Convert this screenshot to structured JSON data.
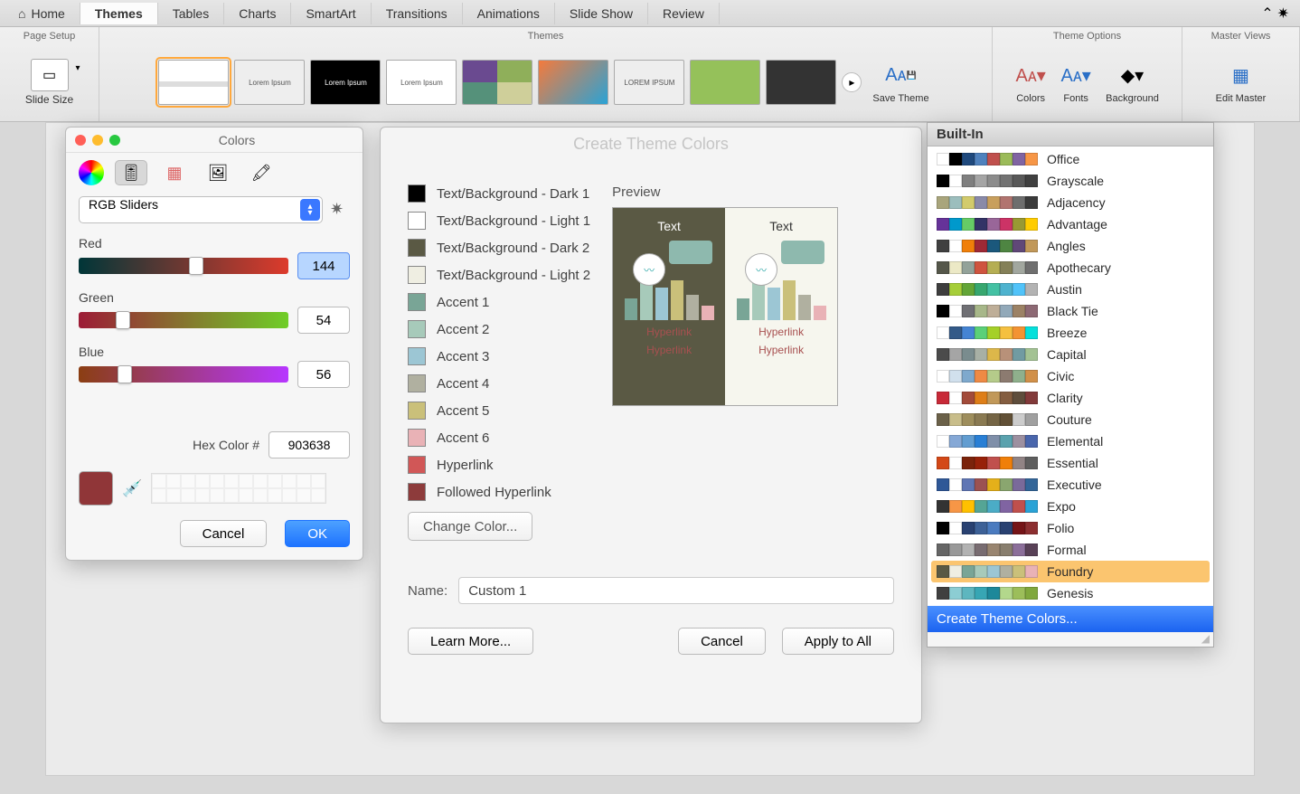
{
  "ribbon": {
    "tabs": [
      "Home",
      "Themes",
      "Tables",
      "Charts",
      "SmartArt",
      "Transitions",
      "Animations",
      "Slide Show",
      "Review"
    ],
    "active_tab": "Themes",
    "groups": {
      "page_setup": "Page Setup",
      "themes": "Themes",
      "theme_options": "Theme Options",
      "master_views": "Master Views"
    },
    "slide_size_label": "Slide Size",
    "save_theme": "Save Theme",
    "colors": "Colors",
    "fonts": "Fonts",
    "background": "Background",
    "edit_master": "Edit Master",
    "theme_thumbs": [
      {
        "label": ""
      },
      {
        "label": "Lorem Ipsum"
      },
      {
        "label": "Lorem Ipsum"
      },
      {
        "label": "Lorem Ipsum"
      },
      {
        "label": ""
      },
      {
        "label": ""
      },
      {
        "label": "LOREM IPSUM"
      },
      {
        "label": ""
      },
      {
        "label": ""
      }
    ]
  },
  "colors_window": {
    "title": "Colors",
    "mode": "RGB Sliders",
    "sliders": {
      "red": {
        "label": "Red",
        "value": "144",
        "pct": 56
      },
      "green": {
        "label": "Green",
        "value": "54",
        "pct": 21
      },
      "blue": {
        "label": "Blue",
        "value": "56",
        "pct": 22
      }
    },
    "hex_label": "Hex Color #",
    "hex_value": "903638",
    "swatch_color": "#903638",
    "cancel": "Cancel",
    "ok": "OK"
  },
  "theme_dialog": {
    "title": "Create Theme Colors",
    "slots": [
      {
        "label": "Text/Background - Dark 1",
        "color": "#000000"
      },
      {
        "label": "Text/Background - Light 1",
        "color": "#ffffff"
      },
      {
        "label": "Text/Background - Dark 2",
        "color": "#5a5944"
      },
      {
        "label": "Text/Background - Light 2",
        "color": "#efeee2"
      },
      {
        "label": "Accent 1",
        "color": "#79a596"
      },
      {
        "label": "Accent 2",
        "color": "#a7caba"
      },
      {
        "label": "Accent 3",
        "color": "#9cc6d4"
      },
      {
        "label": "Accent 4",
        "color": "#b0b0a0"
      },
      {
        "label": "Accent 5",
        "color": "#cac07a"
      },
      {
        "label": "Accent 6",
        "color": "#e9b2b6"
      },
      {
        "label": "Hyperlink",
        "color": "#d15757"
      },
      {
        "label": "Followed Hyperlink",
        "color": "#8d3b3b"
      }
    ],
    "preview_label": "Preview",
    "preview_text": "Text",
    "preview_hyperlink": "Hyperlink",
    "change_color": "Change Color...",
    "name_label": "Name:",
    "name_value": "Custom 1",
    "learn_more": "Learn More...",
    "cancel": "Cancel",
    "apply_all": "Apply to All"
  },
  "theme_panel": {
    "header": "Built-In",
    "create": "Create Theme Colors...",
    "selected": "Foundry",
    "items": [
      {
        "name": "Office",
        "c": [
          "#ffffff",
          "#000000",
          "#1f497d",
          "#4f81bd",
          "#c0504d",
          "#9bbb59",
          "#8064a2",
          "#f79646"
        ]
      },
      {
        "name": "Grayscale",
        "c": [
          "#000000",
          "#ffffff",
          "#7f7f7f",
          "#a5a5a5",
          "#8c8c8c",
          "#737373",
          "#595959",
          "#404040"
        ]
      },
      {
        "name": "Adjacency",
        "c": [
          "#a9a57c",
          "#9cbebd",
          "#d2cb6c",
          "#8a8aa8",
          "#c89f5d",
          "#b1746f",
          "#6e6e6e",
          "#3b3b3b"
        ]
      },
      {
        "name": "Advantage",
        "c": [
          "#663399",
          "#0099cc",
          "#66cc66",
          "#333366",
          "#996699",
          "#cc3366",
          "#999933",
          "#ffcc00"
        ]
      },
      {
        "name": "Angles",
        "c": [
          "#404040",
          "#ffffff",
          "#f07f09",
          "#9f2936",
          "#1b587c",
          "#4e8542",
          "#604878",
          "#c19859"
        ]
      },
      {
        "name": "Apothecary",
        "c": [
          "#55574a",
          "#ece9c6",
          "#93a299",
          "#cf543f",
          "#b5ae53",
          "#848058",
          "#a2a79f",
          "#6f6f6f"
        ]
      },
      {
        "name": "Austin",
        "c": [
          "#3e3e3e",
          "#a6ce39",
          "#63a537",
          "#37a76f",
          "#44c1a3",
          "#4eb3cf",
          "#51c3f9",
          "#b3b3b3"
        ]
      },
      {
        "name": "Black Tie",
        "c": [
          "#000000",
          "#ffffff",
          "#6f6f74",
          "#a7b789",
          "#beae98",
          "#92a9b9",
          "#9c8265",
          "#8d6974"
        ]
      },
      {
        "name": "Breeze",
        "c": [
          "#ffffff",
          "#335a88",
          "#4584d3",
          "#5bd078",
          "#a5d028",
          "#f5c040",
          "#f39333",
          "#05e0db"
        ]
      },
      {
        "name": "Capital",
        "c": [
          "#4b4b4b",
          "#a5a5a5",
          "#7a8c8e",
          "#a8b0a5",
          "#dcb74a",
          "#b89179",
          "#719ba2",
          "#a3c293"
        ]
      },
      {
        "name": "Civic",
        "c": [
          "#ffffff",
          "#d1e0ed",
          "#7ea9cd",
          "#ee8a45",
          "#b5cb8a",
          "#8c7b70",
          "#8fb08c",
          "#d19049"
        ]
      },
      {
        "name": "Clarity",
        "c": [
          "#c82a38",
          "#ffffff",
          "#a24b3a",
          "#de7e18",
          "#c19859",
          "#845d40",
          "#5e4d3c",
          "#823a3a"
        ]
      },
      {
        "name": "Couture",
        "c": [
          "#6b6149",
          "#c8bd8a",
          "#9e8e5c",
          "#8a7a52",
          "#756545",
          "#615036",
          "#cccccc",
          "#a0a0a0"
        ]
      },
      {
        "name": "Elemental",
        "c": [
          "#ffffff",
          "#85a8d6",
          "#629dd1",
          "#297fd5",
          "#7f8fa9",
          "#5aa2ae",
          "#9d90a0",
          "#4a66ac"
        ]
      },
      {
        "name": "Essential",
        "c": [
          "#d34817",
          "#ffffff",
          "#7b230b",
          "#972109",
          "#c0504d",
          "#f07f09",
          "#918485",
          "#5e5e5e"
        ]
      },
      {
        "name": "Executive",
        "c": [
          "#2f5897",
          "#ffffff",
          "#6076b4",
          "#9c5252",
          "#e4b01a",
          "#8aa66f",
          "#7a6a9a",
          "#336699"
        ]
      },
      {
        "name": "Expo",
        "c": [
          "#333333",
          "#f79646",
          "#ffc000",
          "#55a595",
          "#4bacc6",
          "#8064a2",
          "#c0504d",
          "#2aa3d6"
        ]
      },
      {
        "name": "Folio",
        "c": [
          "#000000",
          "#ffffff",
          "#294171",
          "#3d6197",
          "#4a7bbf",
          "#294171",
          "#751417",
          "#8c2e30"
        ]
      },
      {
        "name": "Formal",
        "c": [
          "#666666",
          "#999999",
          "#b2b2b2",
          "#786c71",
          "#998570",
          "#887e6e",
          "#8c6f9a",
          "#594157"
        ]
      },
      {
        "name": "Foundry",
        "c": [
          "#5a5944",
          "#efeee2",
          "#79a596",
          "#a7caba",
          "#9cc6d4",
          "#b0b0a0",
          "#cac07a",
          "#e9b2b6"
        ]
      },
      {
        "name": "Genesis",
        "c": [
          "#404040",
          "#8ccdd3",
          "#5db6bf",
          "#37a6b4",
          "#1d889a",
          "#b3d88c",
          "#9cbe5a",
          "#80a83d"
        ]
      }
    ]
  }
}
